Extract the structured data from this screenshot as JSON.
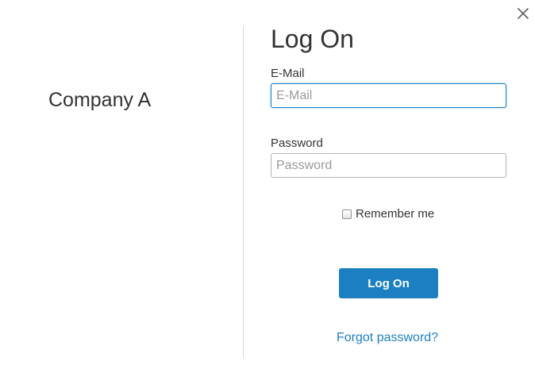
{
  "dialog": {
    "close_icon": "close-icon"
  },
  "brand": {
    "company_name": "Company A"
  },
  "form": {
    "title": "Log On",
    "email_label": "E-Mail",
    "email_value": "",
    "email_placeholder": "E-Mail",
    "password_label": "Password",
    "password_value": "",
    "password_placeholder": "Password",
    "remember_label": "Remember me",
    "remember_checked": false,
    "submit_label": "Log On",
    "forgot_label": "Forgot password?"
  },
  "colors": {
    "accent": "#1b7fc1",
    "focus_border": "#1b82c4",
    "text": "#333333",
    "placeholder": "#9a9a9a",
    "divider": "#d9d9d9"
  }
}
